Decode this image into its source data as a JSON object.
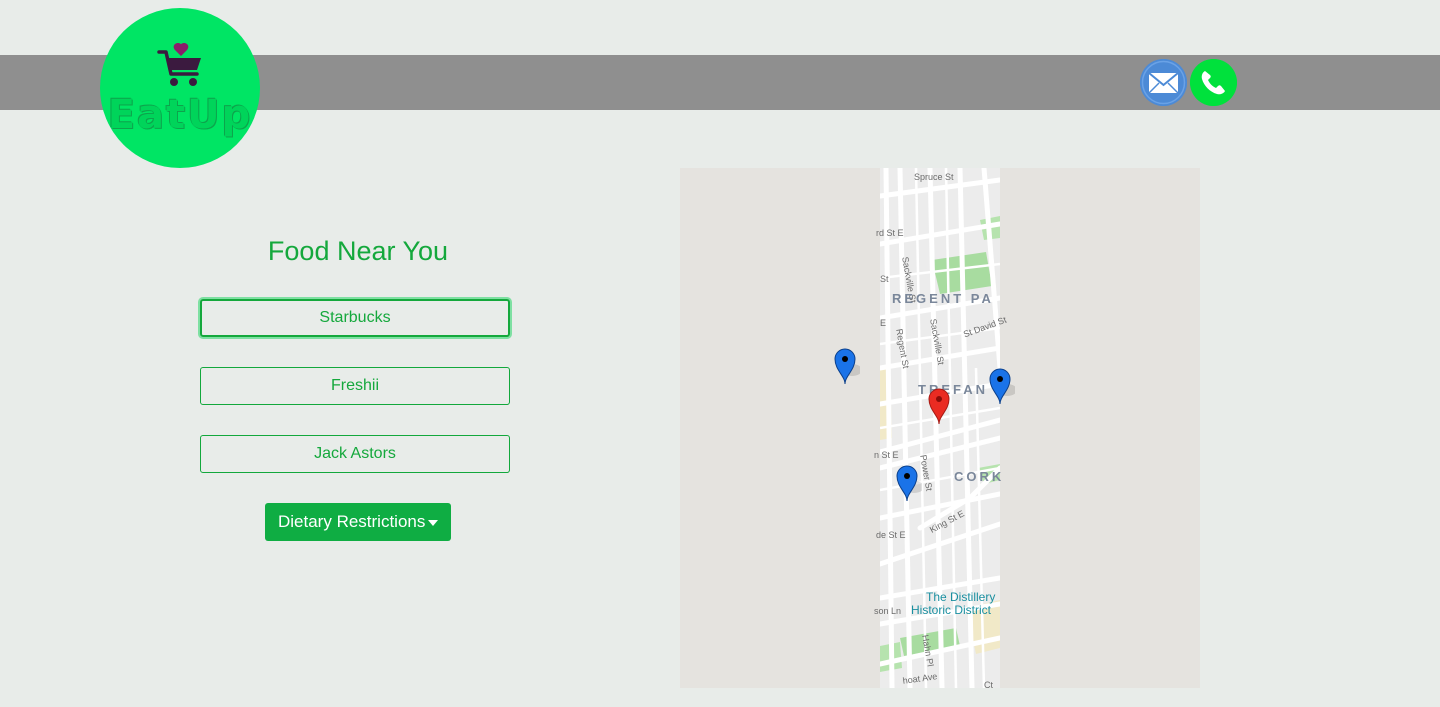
{
  "header": {
    "logo_text": "EatUp",
    "icons": {
      "logo": "shopping-cart-heart-icon",
      "mail": "mail-icon",
      "phone": "phone-icon"
    },
    "colors": {
      "band": "#8f8f8f",
      "logo_bg": "#00e564"
    }
  },
  "main": {
    "title": "Food Near You",
    "places": [
      {
        "label": "Starbucks",
        "active": true
      },
      {
        "label": "Freshii",
        "active": false
      },
      {
        "label": "Jack Astors",
        "active": false
      }
    ],
    "dietary_button": "Dietary Restrictions",
    "accent_color": "#14a83c"
  },
  "map": {
    "streets": [
      "Spruce St",
      "rd St E",
      "Sackville St",
      "St",
      "E",
      "Regent St",
      "Sackville St",
      "St David St",
      "n St E",
      "Power St",
      "de St E",
      "King St E",
      "son Ln",
      "Hahn Pl",
      "hoat Ave",
      "Ct"
    ],
    "districts": [
      "REGENT PA",
      "TREFAN",
      "CORK"
    ],
    "poi": [
      "The Distillery",
      "Historic District"
    ],
    "markers": [
      {
        "name": "marker-blue-1",
        "color": "#1a73e8"
      },
      {
        "name": "marker-blue-2",
        "color": "#1a73e8"
      },
      {
        "name": "marker-blue-3",
        "color": "#1a73e8"
      },
      {
        "name": "marker-red-current",
        "color": "#ea2b22"
      }
    ]
  }
}
